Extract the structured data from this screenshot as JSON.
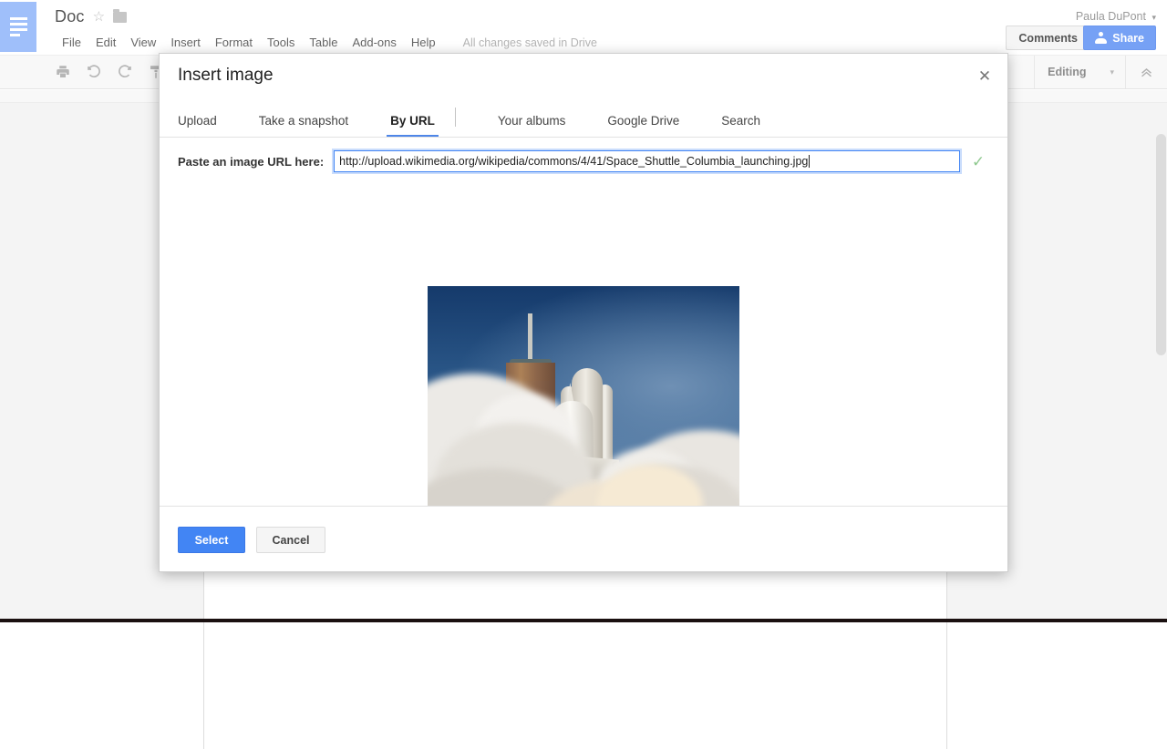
{
  "app": {
    "doc_title": "Doc",
    "star_icon": "star-outline-icon",
    "folder_icon": "folder-icon",
    "account_name": "Paula DuPont",
    "account_caret": "▾",
    "save_state": "All changes saved in Drive",
    "comments_label": "Comments",
    "share_label": "Share",
    "menus": [
      "File",
      "Edit",
      "View",
      "Insert",
      "Format",
      "Tools",
      "Table",
      "Add-ons",
      "Help"
    ],
    "toolbar": {
      "print_icon": "print-icon",
      "undo_icon": "undo-icon",
      "redo_icon": "redo-icon",
      "paint_format_icon": "paint-format-icon",
      "mode_label": "Editing",
      "mode_caret": "▾",
      "collapse_icon": "chevron-double-up-icon"
    }
  },
  "dialog": {
    "title": "Insert image",
    "close_icon": "close-icon",
    "tabs": [
      {
        "label": "Upload",
        "active": false
      },
      {
        "label": "Take a snapshot",
        "active": false
      },
      {
        "label": "By URL",
        "active": true
      },
      {
        "label": "Your albums",
        "active": false
      },
      {
        "label": "Google Drive",
        "active": false
      },
      {
        "label": "Search",
        "active": false
      }
    ],
    "url_field": {
      "label": "Paste an image URL here:",
      "value": "http://upload.wikimedia.org/wikipedia/commons/4/41/Space_Shuttle_Columbia_launching.jpg",
      "placeholder": "Paste an image URL here",
      "valid_icon": "check-mark-icon"
    },
    "preview": {
      "alt": "Space Shuttle Columbia launching",
      "image_name": "space-shuttle-launch-photo"
    },
    "buttons": {
      "select": "Select",
      "cancel": "Cancel"
    }
  },
  "colors": {
    "accent_blue": "#4285f4",
    "tab_underline": "#4e86e8",
    "share_blue": "#76a1f5",
    "check_green": "#8fc98f",
    "logo_blue": "#9fbffa"
  }
}
